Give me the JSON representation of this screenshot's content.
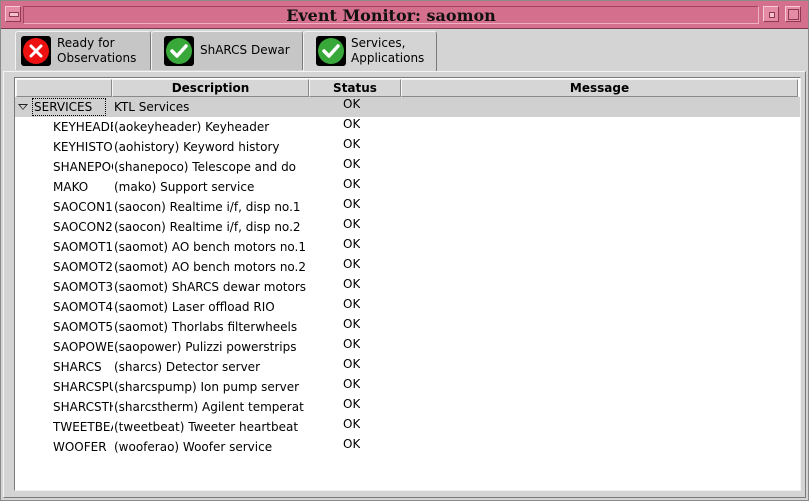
{
  "window": {
    "title": "Event Monitor: saomon"
  },
  "tabs": [
    {
      "label": "Ready for\nObservations",
      "icon": "error-x-icon",
      "active": false
    },
    {
      "label": "ShARCS Dewar",
      "icon": "checkmark-icon",
      "active": false
    },
    {
      "label": "Services,\nApplications",
      "icon": "checkmark-icon",
      "active": true
    }
  ],
  "table": {
    "columns": {
      "name": "",
      "description": "Description",
      "status": "Status",
      "message": "Message"
    },
    "group": {
      "name": "SERVICES",
      "description": "KTL Services",
      "status": "OK",
      "message": ""
    },
    "rows": [
      {
        "name": "KEYHEADER",
        "description": "(aokeyheader) Keyheader",
        "status": "OK",
        "message": ""
      },
      {
        "name": "KEYHISTORY",
        "description": "(aohistory) Keyword history",
        "status": "OK",
        "message": ""
      },
      {
        "name": "SHANEPOCO",
        "description": "(shanepoco) Telescope and do",
        "status": "OK",
        "message": ""
      },
      {
        "name": "MAKO",
        "description": "(mako) Support service",
        "status": "OK",
        "message": ""
      },
      {
        "name": "SAOCON1",
        "description": "(saocon) Realtime i/f, disp no.1",
        "status": "OK",
        "message": ""
      },
      {
        "name": "SAOCON2",
        "description": "(saocon) Realtime i/f, disp no.2",
        "status": "OK",
        "message": ""
      },
      {
        "name": "SAOMOT1",
        "description": "(saomot) AO bench motors no.1",
        "status": "OK",
        "message": ""
      },
      {
        "name": "SAOMOT2",
        "description": "(saomot) AO bench motors no.2",
        "status": "OK",
        "message": ""
      },
      {
        "name": "SAOMOT3",
        "description": "(saomot) ShARCS dewar motors",
        "status": "OK",
        "message": ""
      },
      {
        "name": "SAOMOT4",
        "description": "(saomot) Laser offload RIO",
        "status": "OK",
        "message": ""
      },
      {
        "name": "SAOMOT5",
        "description": "(saomot) Thorlabs filterwheels",
        "status": "OK",
        "message": ""
      },
      {
        "name": "SAOPOWER",
        "description": "(saopower) Pulizzi powerstrips",
        "status": "OK",
        "message": ""
      },
      {
        "name": "SHARCS",
        "description": "(sharcs) Detector server",
        "status": "OK",
        "message": ""
      },
      {
        "name": "SHARCSPUMP",
        "description": "(sharcspump) Ion pump server",
        "status": "OK",
        "message": ""
      },
      {
        "name": "SHARCSTHERM",
        "description": "(sharcstherm) Agilent temperat",
        "status": "OK",
        "message": ""
      },
      {
        "name": "TWEETBEAT",
        "description": "(tweetbeat) Tweeter heartbeat",
        "status": "OK",
        "message": ""
      },
      {
        "name": "WOOFER",
        "description": "(wooferao) Woofer service",
        "status": "OK",
        "message": ""
      }
    ]
  },
  "colors": {
    "titlebar": "#d56f8e",
    "error": "#e11111",
    "ok": "#39a83a"
  }
}
